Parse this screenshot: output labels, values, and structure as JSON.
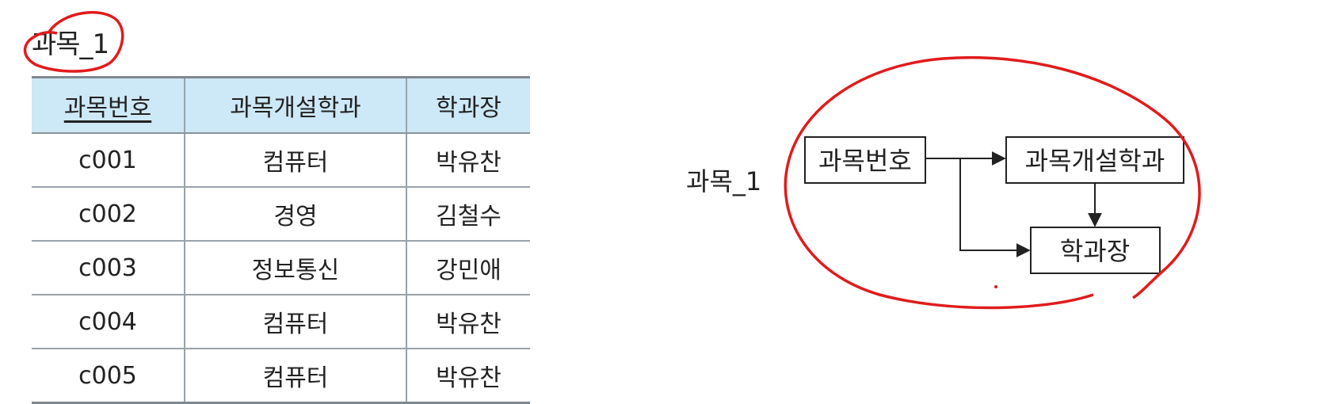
{
  "table": {
    "title": "과목_1",
    "headers": [
      "과목번호",
      "과목개설학과",
      "학과장"
    ],
    "primary_key": "과목번호",
    "rows": [
      [
        "c001",
        "컴퓨터",
        "박유찬"
      ],
      [
        "c002",
        "경영",
        "김철수"
      ],
      [
        "c003",
        "정보통신",
        "강민애"
      ],
      [
        "c004",
        "컴퓨터",
        "박유찬"
      ],
      [
        "c005",
        "컴퓨터",
        "박유찬"
      ]
    ]
  },
  "diagram": {
    "relation_label": "과목_1",
    "nodes": {
      "subject_id": "과목번호",
      "department": "과목개설학과",
      "dept_head": "학과장"
    },
    "dependencies": [
      [
        "과목번호",
        "과목개설학과"
      ],
      [
        "과목번호",
        "학과장"
      ],
      [
        "과목개설학과",
        "학과장"
      ]
    ]
  },
  "annotations": {
    "circle_color": "#e11b1b",
    "header_color": "#cde8f6"
  }
}
